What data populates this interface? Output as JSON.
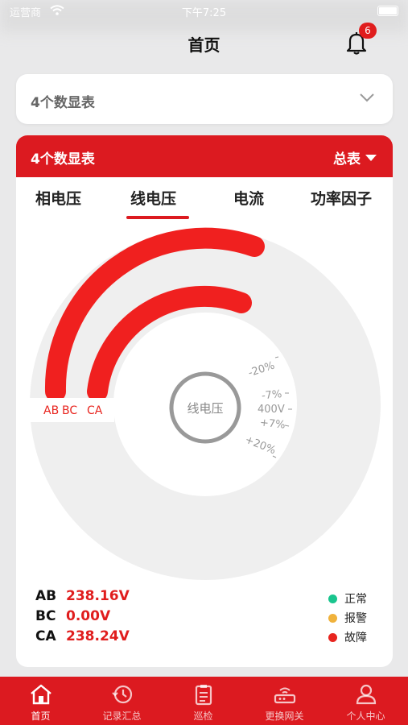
{
  "status_bar": {
    "carrier": "运营商",
    "time": "下午7:25"
  },
  "header": {
    "title": "首页",
    "notification_count": "6"
  },
  "selector": {
    "value": "4个数显表"
  },
  "card": {
    "title": "4个数显表",
    "meter_select": "总表",
    "tabs": [
      "相电压",
      "线电压",
      "电流",
      "功率因子"
    ],
    "active_tab": 1,
    "gauge": {
      "center_label": "线电压",
      "ring_labels": [
        "AB",
        "BC",
        "CA"
      ],
      "scale_labels": [
        "-20%",
        "-7%",
        "400V",
        "+7%",
        "+20%"
      ]
    },
    "readings": [
      {
        "label": "AB",
        "value": "238.16V"
      },
      {
        "label": "BC",
        "value": "0.00V"
      },
      {
        "label": "CA",
        "value": "238.24V"
      }
    ],
    "status_legend": [
      {
        "label": "正常",
        "color": "#19c58e"
      },
      {
        "label": "报警",
        "color": "#f0b23c"
      },
      {
        "label": "故障",
        "color": "#e8251f"
      }
    ]
  },
  "nav": {
    "items": [
      "首页",
      "记录汇总",
      "巡检",
      "更换网关",
      "个人中心"
    ],
    "active": 0
  },
  "colors": {
    "brand_red": "#dc1a20",
    "value_red": "#e01d1d"
  }
}
